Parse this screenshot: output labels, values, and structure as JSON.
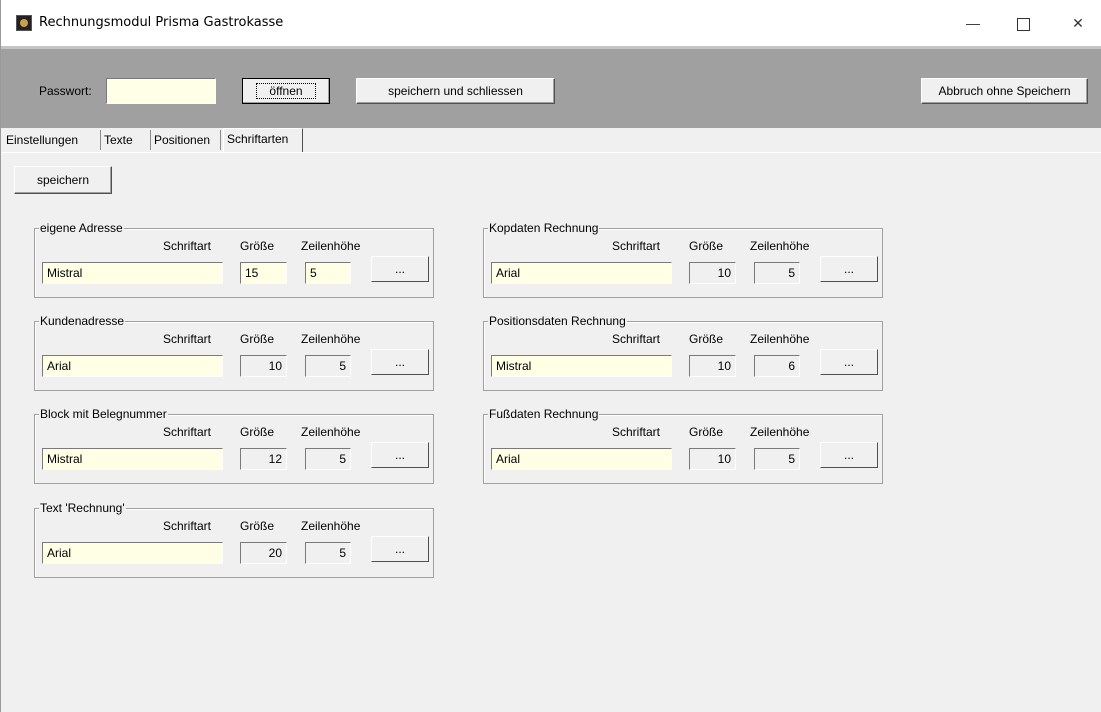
{
  "window": {
    "title": "Rechnungsmodul Prisma Gastrokasse",
    "minimize_glyph": "—",
    "close_glyph": "✕"
  },
  "header": {
    "password_label": "Passwort:",
    "password_value": "",
    "open_label": "öffnen",
    "save_close_label": "speichern und schliessen",
    "abort_label": "Abbruch ohne Speichern"
  },
  "tabs": [
    "Einstellungen",
    "Texte",
    "Positionen",
    "Schriftarten"
  ],
  "active_tab": "Schriftarten",
  "save_label": "speichern",
  "column_labels": {
    "font": "Schriftart",
    "size": "Größe",
    "line_height": "Zeilenhöhe"
  },
  "browse_label": "...",
  "groups": [
    {
      "title": "eigene Adresse",
      "font": "Mistral",
      "size": "15",
      "line_height": "5"
    },
    {
      "title": "Kopdaten Rechnung",
      "font": "Arial",
      "size": "10",
      "line_height": "5"
    },
    {
      "title": "Kundenadresse",
      "font": "Arial",
      "size": "10",
      "line_height": "5"
    },
    {
      "title": "Positionsdaten Rechnung",
      "font": "Mistral",
      "size": "10",
      "line_height": "6"
    },
    {
      "title": "Block mit Belegnummer",
      "font": "Mistral",
      "size": "12",
      "line_height": "5"
    },
    {
      "title": "Fußdaten Rechnung",
      "font": "Arial",
      "size": "10",
      "line_height": "5"
    },
    {
      "title": "Text 'Rechnung'",
      "font": "Arial",
      "size": "20",
      "line_height": "5"
    }
  ],
  "colors": {
    "header_bg": "#a0a0a0",
    "field_bg": "#ffffe6",
    "window_bg": "#f0f0f0"
  }
}
